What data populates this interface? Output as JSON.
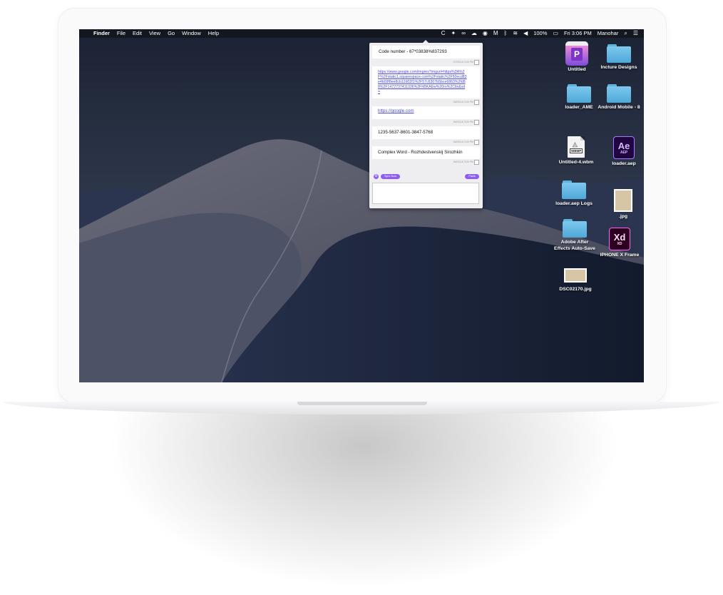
{
  "menubar": {
    "app_name": "Finder",
    "menus": [
      "File",
      "Edit",
      "View",
      "Go",
      "Window",
      "Help"
    ],
    "battery": "100%",
    "clock": "Fri 3:06 PM",
    "user": "Manohar"
  },
  "clipboard": {
    "items": [
      {
        "text": "Code number - 67*03838%837293",
        "time": "07/03/18 3:04 PM"
      },
      {
        "text": "https://www.google.com/imgres?imgurl=https%3A%2F%2Fstatic1.squarespace.com%2Fstatic%2F50ecd83e4b09f8ee8cb12d02f1%2F57c6307b5bce6863%2fd88%2F1472737411336%2FhBKAEw%20ro%2Clin&vd=",
        "time": "06/03/18 3:04 PM"
      },
      {
        "text": "https://google.com",
        "time": "06/03/18 3:04 PM"
      },
      {
        "text": "1235-5637-8601-3847-5768",
        "time": "06/03/18 3:04 PM"
      },
      {
        "text": "Complex Word - Rozhdestvenskij Sirozhkin",
        "time": "06/03/18 3:04 PM"
      }
    ],
    "sync_label": "Sync Now",
    "paste_label": "Paste"
  },
  "desktop": [
    {
      "label": "Untitled"
    },
    {
      "label": "Incture Designs"
    },
    {
      "label": "loader_AME"
    },
    {
      "label": "Android Mobile - 8"
    },
    {
      "label": "Untitled-4.wbm"
    },
    {
      "label": "loader.aep"
    },
    {
      "label": "loader.aep Logs"
    },
    {
      "label": ".jpg"
    },
    {
      "label": "Adobe After Effects Auto-Save"
    },
    {
      "label": "IPHONE X Frame"
    },
    {
      "label": "DSC02170.jpg"
    }
  ],
  "icon_text": {
    "ae": "Ae",
    "ae_sub": "AEP",
    "xd": "Xd",
    "xd_sub": "XD",
    "webm": "WBMP",
    "pages_letter": "P"
  }
}
